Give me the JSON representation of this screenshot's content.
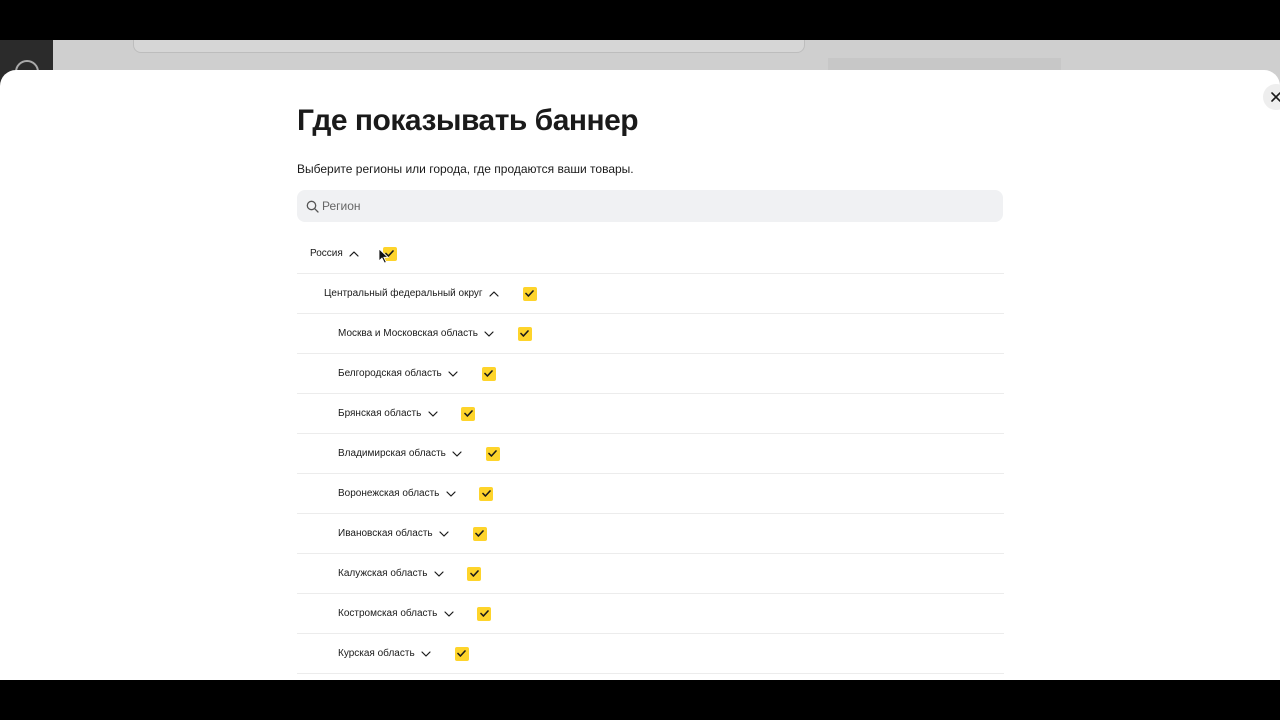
{
  "modal": {
    "title": "Где показывать баннер",
    "subtitle": "Выберите регионы или города, где продаются ваши товары.",
    "close_icon": "close-icon"
  },
  "search": {
    "placeholder": "Регион",
    "value": "",
    "icon": "search-icon"
  },
  "regions": [
    {
      "label": "Россия",
      "expanded": true,
      "checked": true,
      "level": 0
    },
    {
      "label": "Центральный федеральный округ",
      "expanded": true,
      "checked": true,
      "level": 1
    },
    {
      "label": "Москва и Московская область",
      "expanded": false,
      "checked": true,
      "level": 2
    },
    {
      "label": "Белгородская область",
      "expanded": false,
      "checked": true,
      "level": 2
    },
    {
      "label": "Брянская область",
      "expanded": false,
      "checked": true,
      "level": 2
    },
    {
      "label": "Владимирская область",
      "expanded": false,
      "checked": true,
      "level": 2
    },
    {
      "label": "Воронежская область",
      "expanded": false,
      "checked": true,
      "level": 2
    },
    {
      "label": "Ивановская область",
      "expanded": false,
      "checked": true,
      "level": 2
    },
    {
      "label": "Калужская область",
      "expanded": false,
      "checked": true,
      "level": 2
    },
    {
      "label": "Костромская область",
      "expanded": false,
      "checked": true,
      "level": 2
    },
    {
      "label": "Курская область",
      "expanded": false,
      "checked": true,
      "level": 2
    }
  ],
  "colors": {
    "checkbox": "#fed42b",
    "checkmark": "#1a1a1a",
    "search_bg": "#f0f1f3"
  }
}
